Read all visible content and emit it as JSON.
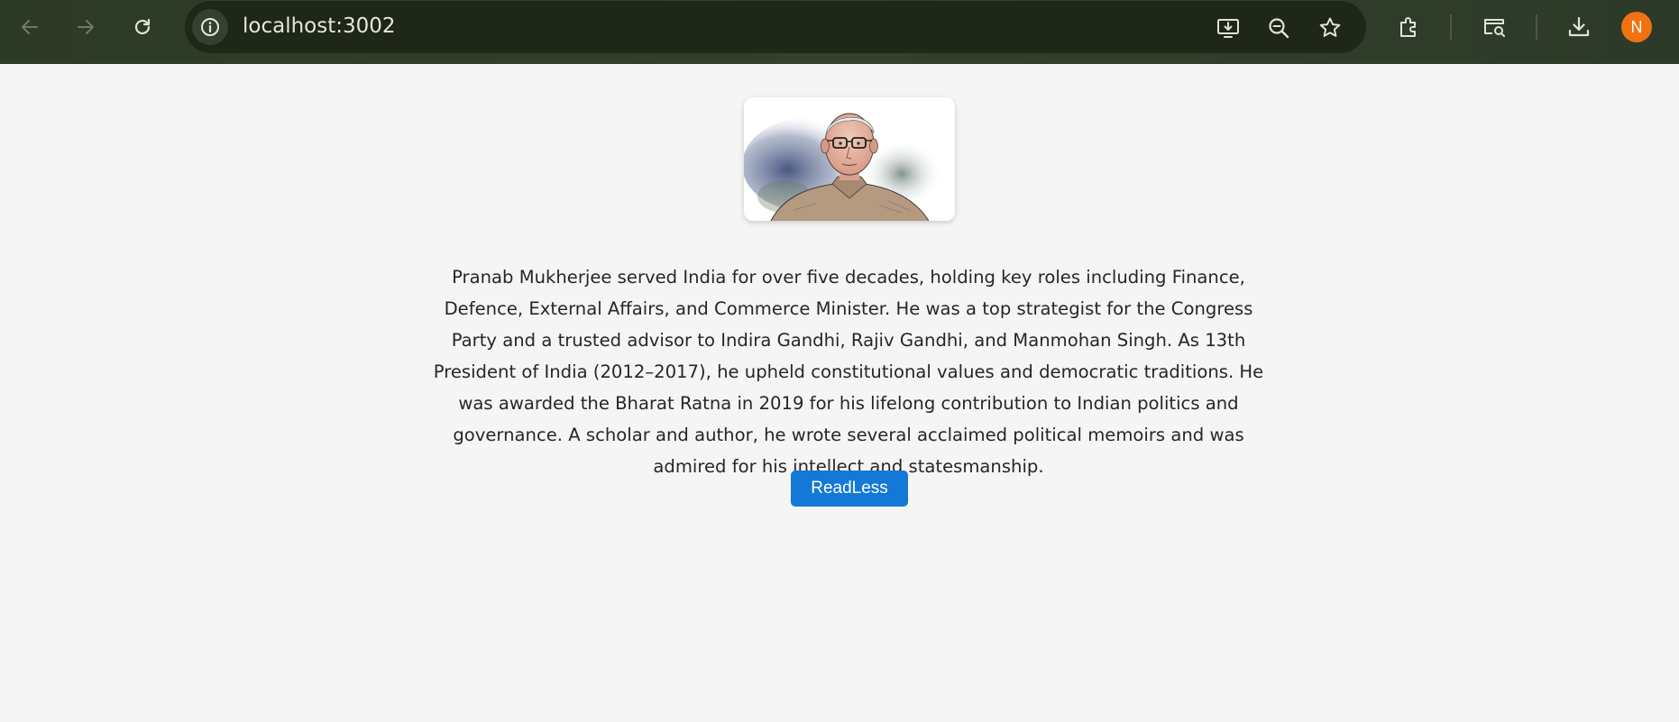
{
  "browser": {
    "url": "localhost:3002",
    "profile_initial": "N",
    "icons": {
      "back": "arrow-left-icon",
      "forward": "arrow-right-icon",
      "reload": "reload-icon",
      "site_info": "info-icon",
      "install": "install-app-icon",
      "zoom": "zoom-out-icon",
      "bookmark": "star-icon",
      "extensions": "puzzle-icon",
      "tab_search": "tab-search-icon",
      "downloads": "download-icon"
    },
    "colors": {
      "toolbar": "#2d3a26",
      "omnibox": "#1e2718",
      "avatar": "#f07312"
    }
  },
  "page": {
    "portrait": "pranab-mukherjee-portrait",
    "bio": "Pranab Mukherjee served India for over five decades, holding key roles including Finance, Defence, External Affairs, and Commerce Minister. He was a top strategist for the Congress Party and a trusted advisor to Indira Gandhi, Rajiv Gandhi, and Manmohan Singh. As 13th President of India (2012–2017), he upheld constitutional values and democratic traditions. He was awarded the Bharat Ratna in 2019 for his lifelong contribution to Indian politics and governance. A scholar and author, he wrote several acclaimed political memoirs and was admired for his intellect and statesmanship.",
    "toggle_label": "ReadLess",
    "colors": {
      "background": "#f5f5f5",
      "button": "#1378d6",
      "text": "#262626"
    }
  }
}
